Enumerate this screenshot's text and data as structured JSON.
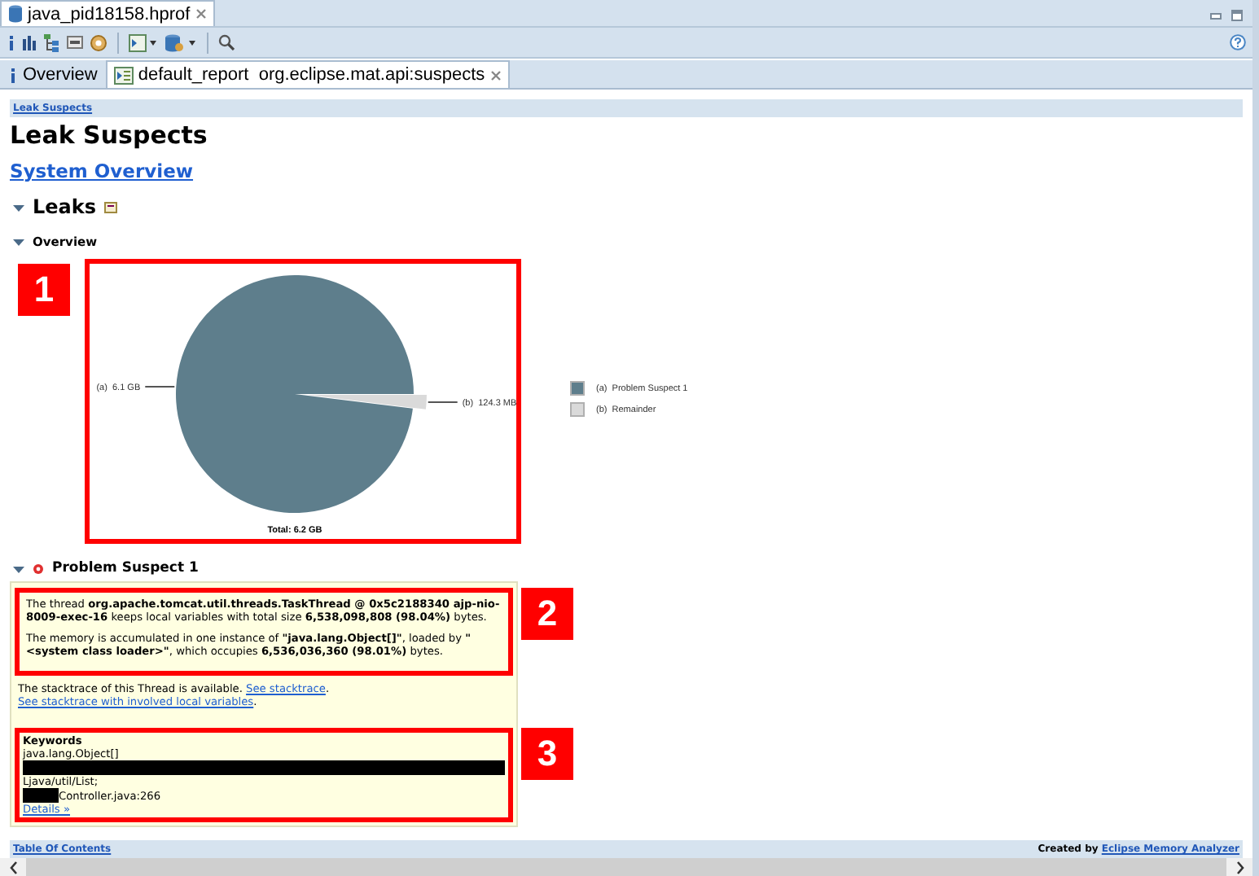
{
  "editor_tab": {
    "title": "java_pid18158.hprof",
    "selected": true
  },
  "view_tabs": [
    {
      "label": "Overview",
      "kind": "info",
      "selected": false
    },
    {
      "label": "default_report  org.eclipse.mat.api:suspects",
      "kind": "report",
      "selected": true
    }
  ],
  "breadcrumb": "Leak Suspects",
  "title": "Leak Suspects",
  "system_overview_link": "System Overview",
  "leaks": {
    "heading": "Leaks",
    "expanded": true,
    "overview": {
      "heading": "Overview",
      "expanded": true,
      "annotation": "1",
      "chart_data": {
        "type": "pie",
        "categories": [
          "(a)  Problem Suspect 1",
          "(b)  Remainder"
        ],
        "values": [
          98.05,
          1.95
        ],
        "xlabel": "Total: 6.2 GB"
      },
      "slice_labels": [
        "(a)  6.1 GB",
        "(b)  124.3 MB"
      ],
      "legend": [
        {
          "color": "#5e7e8c"
        },
        {
          "color": "#dadada"
        }
      ]
    }
  },
  "suspect": {
    "heading": "Problem Suspect 1",
    "expanded": true,
    "summary_annotation": "2",
    "paragraphs": [
      "The thread **org.apache.tomcat.util.threads.TaskThread @ 0x5c2188340 ajp-nio-8009-exec-16** keeps local variables with total size **6,538,098,808 (98.04%)** bytes.",
      "The memory is accumulated in one instance of **\"java.lang.Object[]\"**, loaded by **\"<system class loader>\"**, which occupies **6,536,036,360 (98.01%)** bytes."
    ],
    "stacktrace": [
      {
        "kind": "text",
        "text": "The stacktrace of this Thread is available. "
      },
      {
        "kind": "link",
        "text": "See stacktrace"
      },
      {
        "kind": "text",
        "text": ". "
      },
      {
        "kind": "link",
        "text": "See stacktrace with involved local variables"
      },
      {
        "kind": "text",
        "text": "."
      }
    ],
    "keywords": {
      "heading": "Keywords",
      "annotation": "3",
      "lines": [
        {
          "kind": "text",
          "text": "java.lang.Object[]"
        },
        {
          "kind": "redacted"
        },
        {
          "kind": "text",
          "text": "Ljava/util/List;"
        },
        {
          "kind": "redacted-prefix",
          "text": "Controller.java:266"
        }
      ],
      "details_link": "Details »"
    }
  },
  "footer": {
    "toc_link": "Table Of Contents",
    "credit": "Created by",
    "credit_link": "Eclipse Memory Analyzer"
  }
}
